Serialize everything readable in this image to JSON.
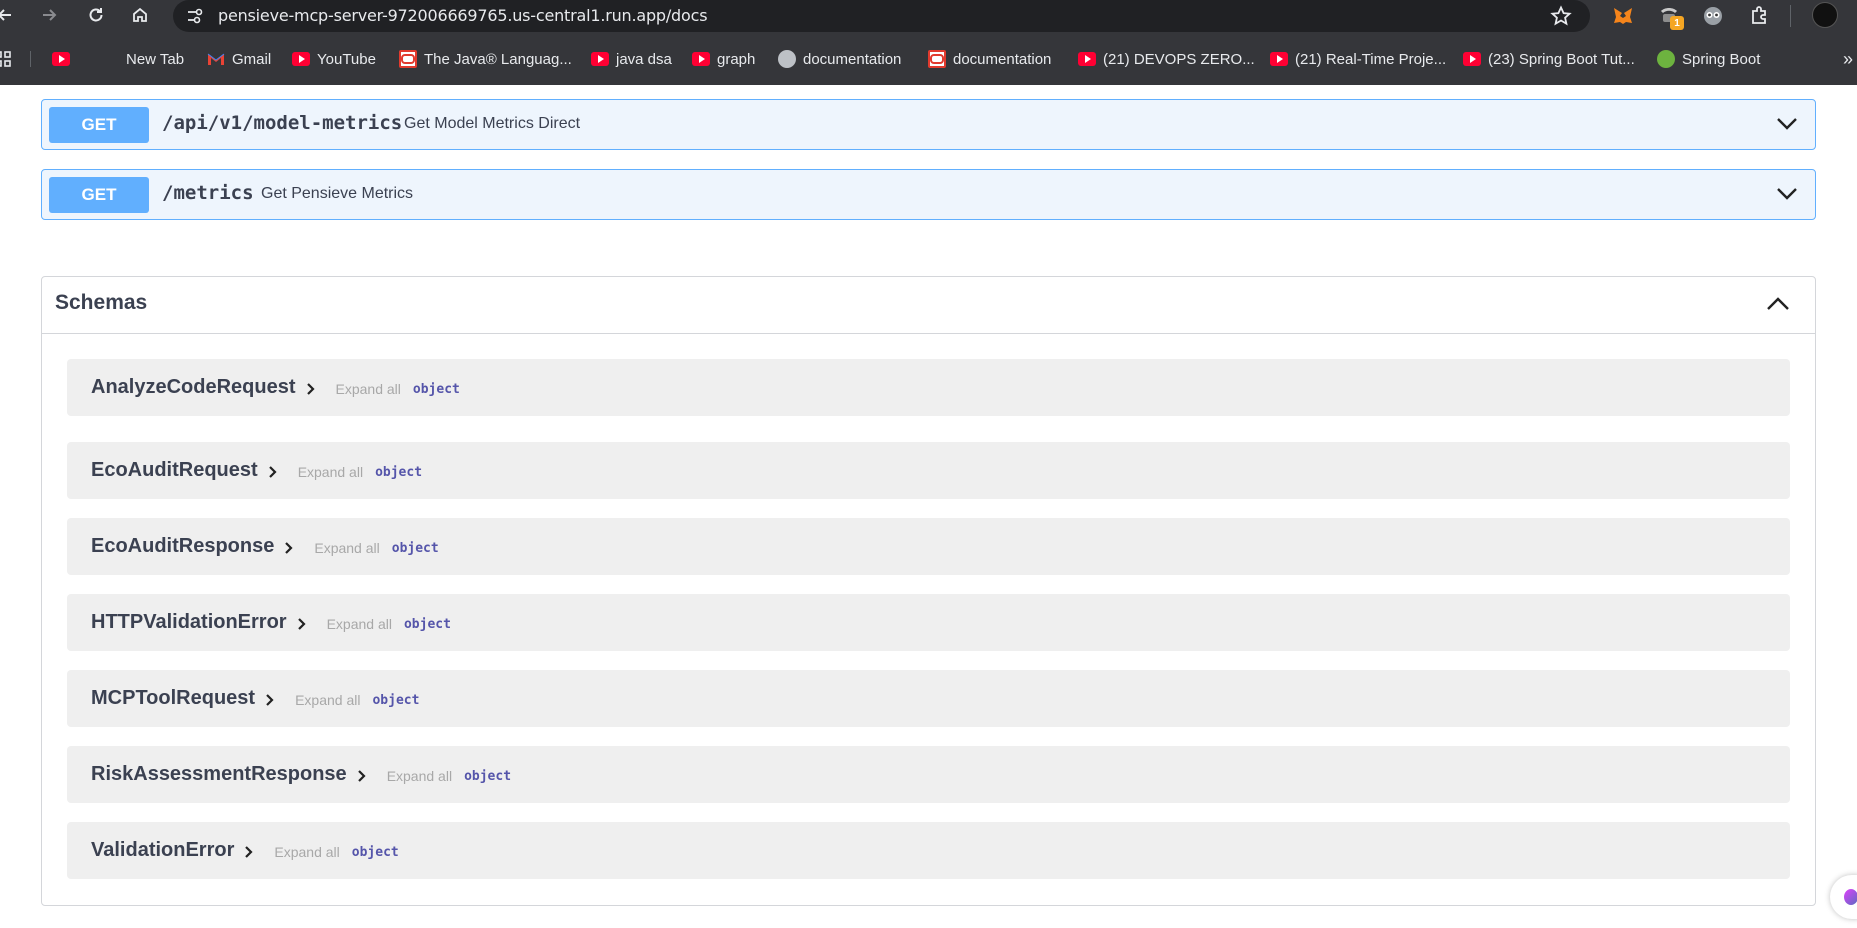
{
  "browser": {
    "url": "pensieve-mcp-server-972006669765.us-central1.run.app/docs",
    "extension_badge": "1",
    "bookmarks": [
      {
        "label": "",
        "icon": "youtube-icon"
      },
      {
        "label": "New Tab",
        "icon": "ghost-icon"
      },
      {
        "label": "Gmail",
        "icon": "gmail-icon"
      },
      {
        "label": "YouTube",
        "icon": "youtube-icon"
      },
      {
        "label": "The Java® Languag...",
        "icon": "oracle-icon"
      },
      {
        "label": "java dsa",
        "icon": "youtube-icon"
      },
      {
        "label": "graph",
        "icon": "youtube-icon"
      },
      {
        "label": "documentation",
        "icon": "globe-icon"
      },
      {
        "label": "documentation",
        "icon": "oracle-icon"
      },
      {
        "label": "(21) DEVOPS ZERO...",
        "icon": "youtube-icon"
      },
      {
        "label": "(21) Real-Time Proje...",
        "icon": "youtube-icon"
      },
      {
        "label": "(23) Spring Boot Tut...",
        "icon": "youtube-icon"
      },
      {
        "label": "Spring Boot",
        "icon": "spring-icon"
      }
    ],
    "overflow": "»"
  },
  "endpoints": [
    {
      "method": "GET",
      "path": "/api/v1/model-metrics",
      "summary": "Get Model Metrics Direct"
    },
    {
      "method": "GET",
      "path": "/metrics",
      "summary": "Get Pensieve Metrics"
    }
  ],
  "schemas": {
    "title": "Schemas",
    "models": [
      {
        "name": "AnalyzeCodeRequest",
        "expand": "Expand all",
        "type": "object"
      },
      {
        "name": "EcoAuditRequest",
        "expand": "Expand all",
        "type": "object"
      },
      {
        "name": "EcoAuditResponse",
        "expand": "Expand all",
        "type": "object"
      },
      {
        "name": "HTTPValidationError",
        "expand": "Expand all",
        "type": "object"
      },
      {
        "name": "MCPToolRequest",
        "expand": "Expand all",
        "type": "object"
      },
      {
        "name": "RiskAssessmentResponse",
        "expand": "Expand all",
        "type": "object"
      },
      {
        "name": "ValidationError",
        "expand": "Expand all",
        "type": "object"
      }
    ]
  },
  "colors": {
    "get_accent": "#61affe",
    "get_bg": "#eef5fd",
    "text": "#3b4151",
    "chrome": "#35363a"
  }
}
